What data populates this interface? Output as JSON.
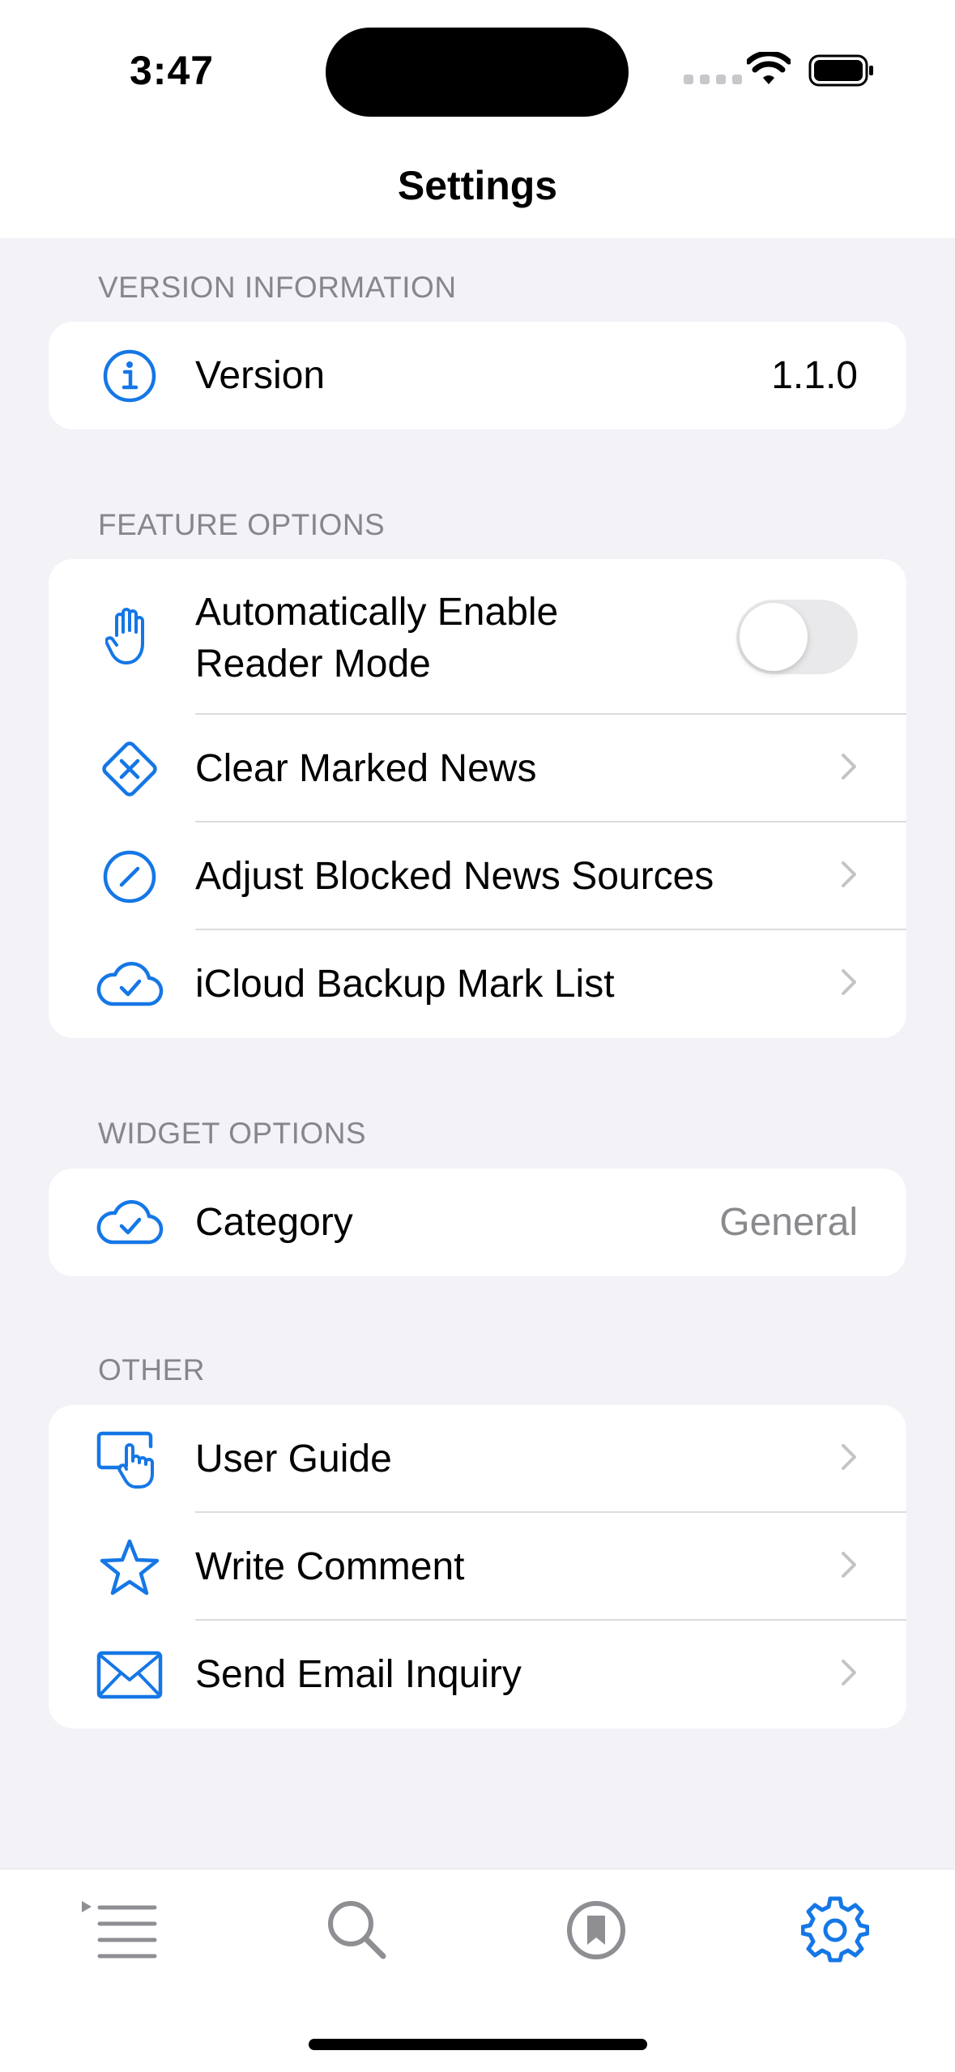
{
  "status_bar": {
    "time": "3:47"
  },
  "nav": {
    "title": "Settings"
  },
  "sections": {
    "version": {
      "header": "VERSION INFORMATION",
      "rows": [
        {
          "label": "Version",
          "value": "1.1.0",
          "icon": "info-circle-icon"
        }
      ]
    },
    "feature": {
      "header": "FEATURE OPTIONS",
      "rows": [
        {
          "label_line1": "Automatically Enable",
          "label_line2": "Reader Mode",
          "icon": "hand-raised-icon",
          "toggle_on": false
        },
        {
          "label": "Clear Marked News",
          "icon": "xmark-diamond-icon"
        },
        {
          "label": "Adjust Blocked News Sources",
          "icon": "slash-circle-icon"
        },
        {
          "label": "iCloud Backup Mark List",
          "icon": "icloud-check-icon"
        }
      ]
    },
    "widget": {
      "header": "WIDGET OPTIONS",
      "rows": [
        {
          "label": "Category",
          "value": "General",
          "icon": "icloud-check-icon"
        }
      ]
    },
    "other": {
      "header": "OTHER",
      "rows": [
        {
          "label": "User Guide",
          "icon": "hand-tap-icon"
        },
        {
          "label": "Write Comment",
          "icon": "star-icon"
        },
        {
          "label": "Send Email Inquiry",
          "icon": "envelope-icon"
        }
      ]
    }
  },
  "tab_bar": {
    "tabs": [
      {
        "icon": "list-icon",
        "selected": false
      },
      {
        "icon": "search-icon",
        "selected": false
      },
      {
        "icon": "bookmark-circle-icon",
        "selected": false
      },
      {
        "icon": "gear-icon",
        "selected": true
      }
    ]
  },
  "colors": {
    "accent": "#1577e6",
    "inactive_tab": "#8e8e93",
    "background": "#f2f2f7"
  }
}
